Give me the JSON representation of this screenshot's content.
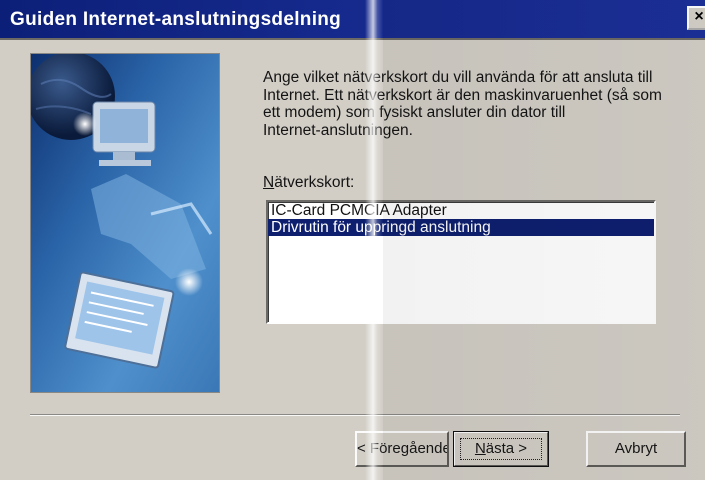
{
  "window": {
    "title": "Guiden Internet-anslutningsdelning",
    "close_glyph": "×"
  },
  "instructions": {
    "line1": "Ange vilket nätverkskort du vill använda för att ansluta till",
    "line2": "Internet. Ett nätverkskort är den maskinvaruenhet (så som",
    "line3": "ett modem) som fysiskt ansluter din dator till",
    "line4": "Internet-anslutningen."
  },
  "adapters": {
    "label_mnemonic": "N",
    "label_rest": "ätverkskort:",
    "items": [
      {
        "label": "IC-Card PCMCIA Adapter",
        "selected": false
      },
      {
        "label": "Drivrutin för uppringd anslutning",
        "selected": true
      }
    ]
  },
  "buttons": {
    "back_label": "< Föregående",
    "next_mnemonic": "N",
    "next_rest": "ästa >",
    "cancel_label": "Avbryt"
  },
  "colors": {
    "titlebar": "#15298c",
    "selection": "#0e1f70",
    "dialog_face": "#d2cec6"
  },
  "icons": {
    "close": "close-icon",
    "illustration": "globe-computer-illustration"
  }
}
